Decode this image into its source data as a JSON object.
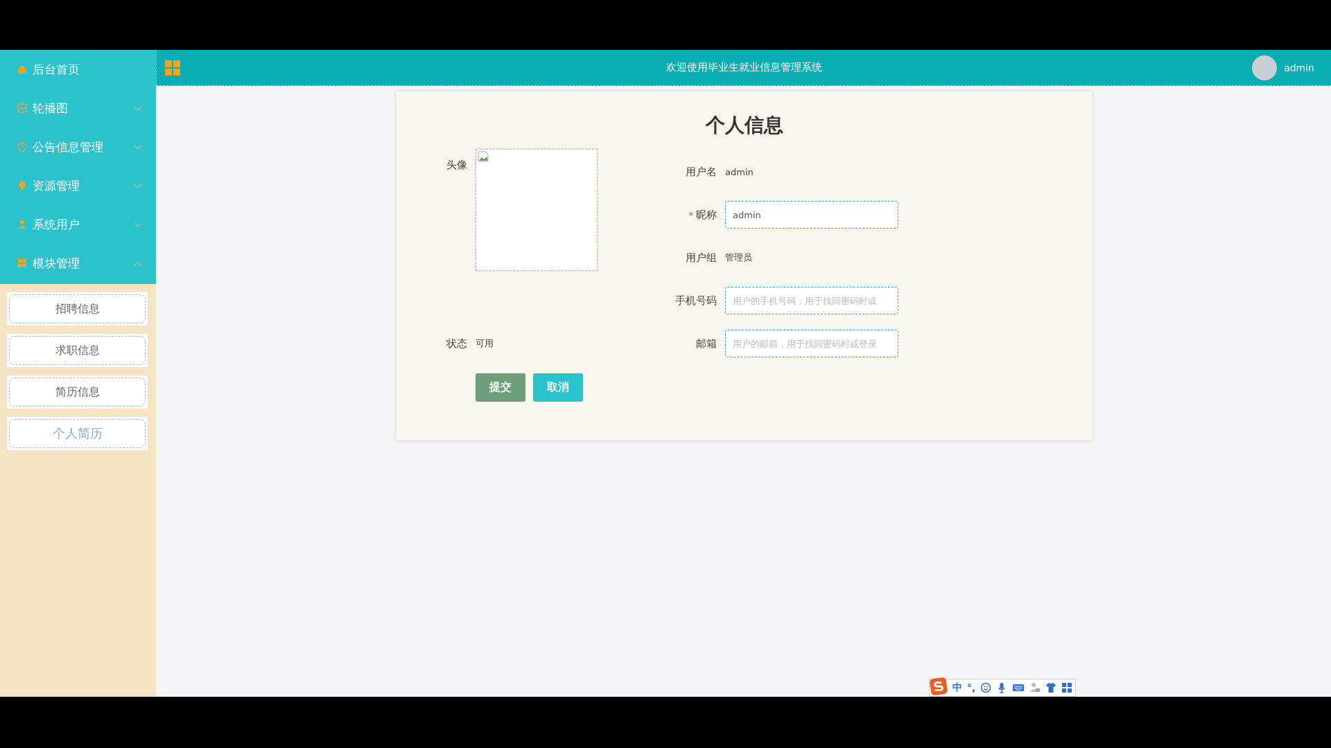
{
  "sidebar": {
    "items": [
      {
        "label": "后台首页",
        "kind": "link"
      },
      {
        "label": "轮播图",
        "kind": "group",
        "expanded": false
      },
      {
        "label": "公告信息管理",
        "kind": "group",
        "expanded": false
      },
      {
        "label": "资源管理",
        "kind": "group",
        "expanded": false
      },
      {
        "label": "系统用户",
        "kind": "group",
        "expanded": false
      },
      {
        "label": "模块管理",
        "kind": "group",
        "expanded": true
      }
    ],
    "submenu": [
      {
        "label": "招聘信息",
        "selected": false
      },
      {
        "label": "求职信息",
        "selected": false
      },
      {
        "label": "简历信息",
        "selected": false
      },
      {
        "label": "个人简历",
        "selected": true
      }
    ]
  },
  "header": {
    "title": "欢迎使用毕业生就业信息管理系统",
    "user": "admin"
  },
  "form": {
    "title": "个人信息",
    "avatar_label": "头像",
    "status": {
      "label": "状态",
      "value": "可用"
    },
    "fields": [
      {
        "label": "用户名",
        "kind": "text",
        "value": "admin"
      },
      {
        "label": "昵称",
        "kind": "input",
        "required_mark": "*",
        "value": "admin"
      },
      {
        "label": "用户组",
        "kind": "text",
        "value": "管理员"
      },
      {
        "label": "手机号码",
        "kind": "input",
        "placeholder": "用户的手机号码，用于找回密码时或"
      },
      {
        "label": "邮箱",
        "kind": "input",
        "placeholder": "用户的邮箱，用于找回密码时或登录"
      }
    ],
    "buttons": [
      {
        "label": "提交",
        "kind": "submit"
      },
      {
        "label": "取消",
        "kind": "cancel"
      }
    ]
  },
  "ime": {
    "mode": "中",
    "punctuation": "°,"
  }
}
